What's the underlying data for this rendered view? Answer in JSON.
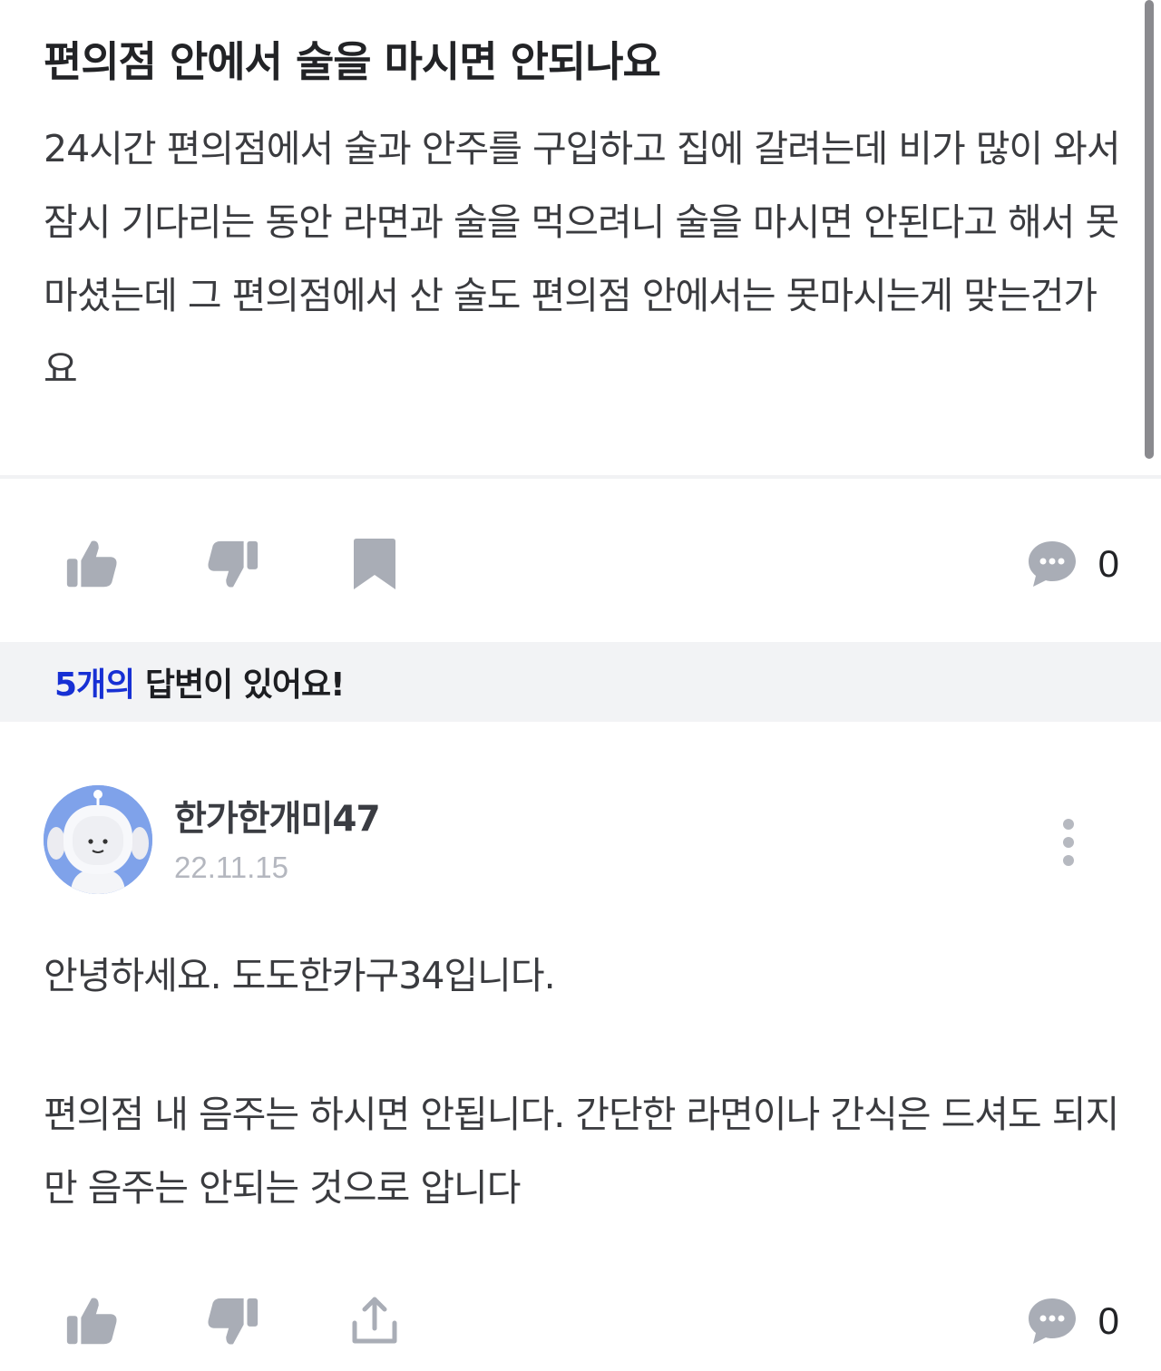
{
  "question": {
    "title": "편의점 안에서 술을 마시면 안되나요",
    "body": "24시간 편의점에서 술과 안주를 구입하고 집에 갈려는데 비가 많이 와서 잠시 기다리는 동안 라면과 술을 먹으려니 술을 마시면 안된다고 해서 못마셨는데 그 편의점에서 산 술도 편의점 안에서는 못마시는게 맞는건가요",
    "comment_count": "0"
  },
  "answers_banner": {
    "count_text": "5개의",
    "rest_text": " 답변이 있어요!"
  },
  "answer": {
    "author": "한가한개미47",
    "date": "22.11.15",
    "greeting": "안녕하세요. 도도한카구34입니다.",
    "body": "편의점 내 음주는 하시면 안됩니다. 간단한 라면이나 간식은 드셔도 되지만 음주는 안되는 것으로 압니다",
    "comment_count": "0"
  },
  "icons": {
    "like": "thumbs-up-icon",
    "dislike": "thumbs-down-icon",
    "bookmark": "bookmark-icon",
    "share": "share-icon",
    "comment": "comment-bubble-icon",
    "more": "more-vertical-icon"
  },
  "colors": {
    "accent_blue": "#1730d4",
    "icon_gray": "#a9adb6",
    "banner_bg": "#f2f3f5"
  }
}
